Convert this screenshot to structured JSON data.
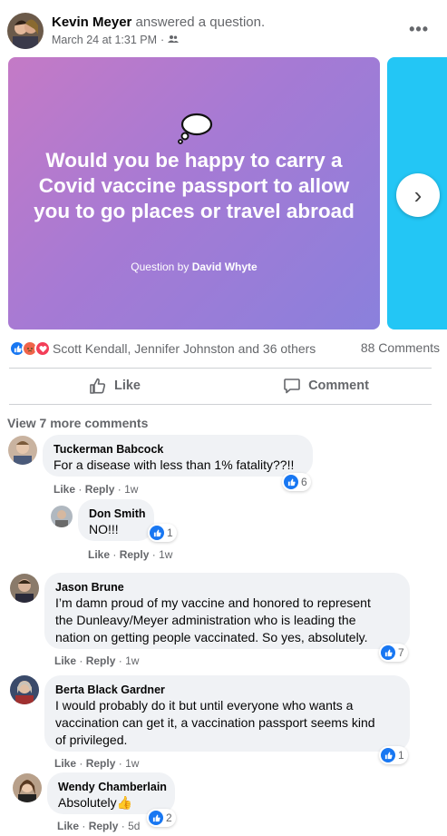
{
  "post": {
    "author": "Kevin Meyer",
    "action": "answered a question.",
    "timestamp": "March 24 at 1:31 PM",
    "separator": "·",
    "audience_icon": "friends-icon",
    "more_label": "•••"
  },
  "question_card": {
    "question": "Would you be happy to carry a Covid vaccine passport to allow you to go places or travel abroad",
    "byline_prefix": "Question by",
    "byline_name": "David Whyte",
    "next_label": "›",
    "colors": {
      "gradient_start": "#c47ac6",
      "gradient_end": "#8a80dc",
      "next_card": "#23c6f5"
    }
  },
  "reactions": {
    "icons": [
      "like-icon",
      "angry-icon",
      "love-icon"
    ],
    "summary": "Scott Kendall, Jennifer Johnston and 36 others",
    "comments": "88 Comments"
  },
  "actions": {
    "like": "Like",
    "comment": "Comment"
  },
  "view_more": "View 7 more comments",
  "comments": [
    {
      "name": "Tuckerman Babcock",
      "lines": [
        "For a disease with less than 1% fatality??!!"
      ],
      "like": "Like",
      "reply": "Reply",
      "sep": "·",
      "time": "1w",
      "likes": "6"
    },
    {
      "name": "Don Smith",
      "lines": [
        "NO!!!"
      ],
      "like": "Like",
      "reply": "Reply",
      "sep": "·",
      "time": "1w",
      "likes": "1"
    },
    {
      "name": "Jason Brune",
      "lines": [
        "I’m damn proud of my vaccine and honored to represent",
        "the Dunleavy/Meyer administration who is leading the",
        "nation on getting people vaccinated. So yes, absolutely."
      ],
      "like": "Like",
      "reply": "Reply",
      "sep": "·",
      "time": "1w",
      "likes": "7"
    },
    {
      "name": "Berta Black Gardner",
      "lines": [
        "I would probably do it but until everyone who wants a",
        "vaccination can get it, a vaccination passport seems kind",
        "of privileged."
      ],
      "like": "Like",
      "reply": "Reply",
      "sep": "·",
      "time": "1w",
      "likes": "1"
    },
    {
      "name": "Wendy Chamberlain",
      "lines": [
        "Absolutely👍"
      ],
      "like": "Like",
      "reply": "Reply",
      "sep": "·",
      "time": "5d",
      "likes": "2"
    }
  ],
  "colors": {
    "accent": "#1877f2",
    "muted_text": "#65676b",
    "bubble_bg": "#f0f2f5"
  }
}
